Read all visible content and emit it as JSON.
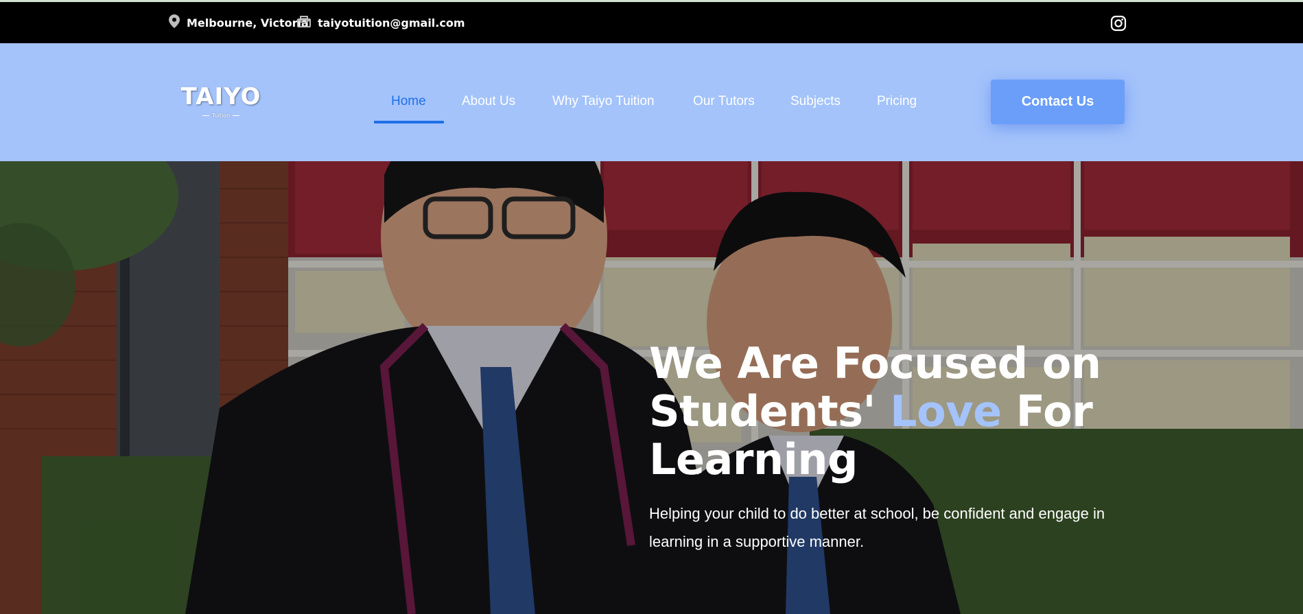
{
  "topbar": {
    "location": "Melbourne, Victoria",
    "email": "taiyotuition@gmail.com",
    "icons": {
      "location": "map-pin-icon",
      "email": "envelope-icon",
      "social": "instagram-icon"
    }
  },
  "header": {
    "logo_title": "TAIYO",
    "logo_subtitle": "Tuition",
    "nav": [
      {
        "label": "Home",
        "active": true
      },
      {
        "label": "About Us",
        "active": false
      },
      {
        "label": "Why Taiyo Tuition",
        "active": false
      },
      {
        "label": "Our Tutors",
        "active": false
      },
      {
        "label": "Subjects",
        "active": false
      },
      {
        "label": "Pricing",
        "active": false
      }
    ],
    "cta_label": "Contact Us"
  },
  "hero": {
    "heading_part1": "We Are Focused on Students' ",
    "heading_accent": "Love",
    "heading_part2": " For Learning",
    "subtext": "Helping your child to do better at school, be confident and engage in learning in a supportive manner."
  },
  "colors": {
    "topbar_bg": "#000000",
    "header_bg": "#a4c3fb",
    "accent_blue": "#1f6fe8",
    "cta_bg": "#6b9ef9",
    "heading_accent": "#a4c3fb"
  }
}
